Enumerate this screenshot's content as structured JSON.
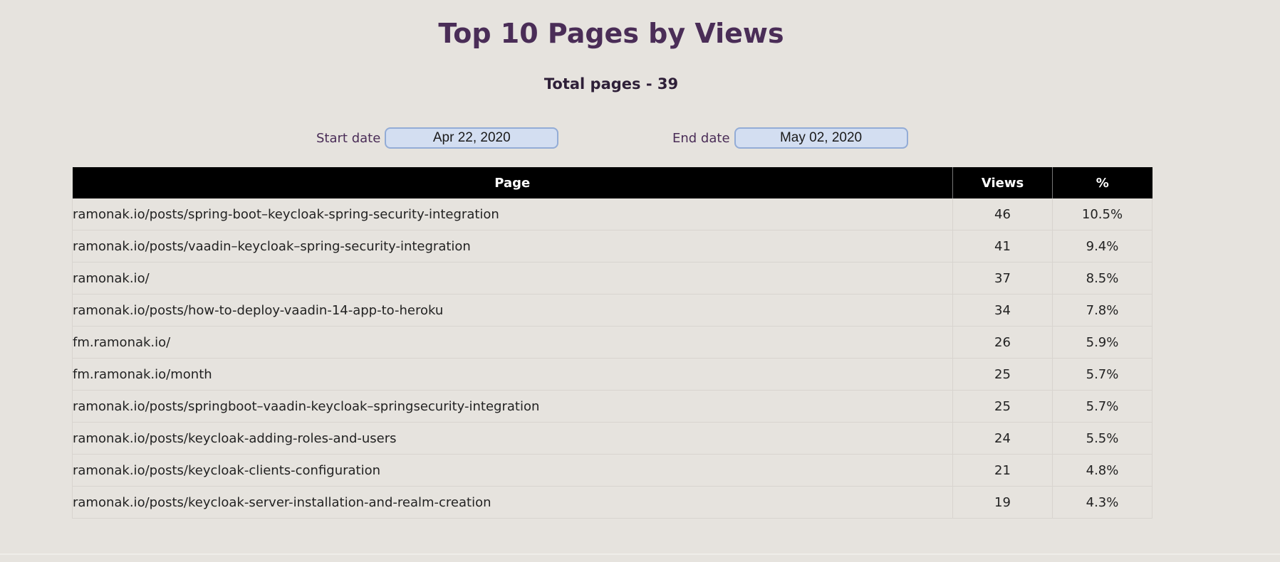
{
  "header": {
    "title": "Top 10 Pages by Views",
    "subtitle": "Total pages - 39"
  },
  "filters": {
    "start_label": "Start date",
    "start_value": "Apr 22, 2020",
    "end_label": "End date",
    "end_value": "May 02, 2020"
  },
  "table": {
    "columns": [
      "Page",
      "Views",
      "%"
    ],
    "rows": [
      {
        "page": "ramonak.io/posts/spring-boot–keycloak-spring-security-integration",
        "views": "46",
        "percent": "10.5%"
      },
      {
        "page": "ramonak.io/posts/vaadin–keycloak–spring-security-integration",
        "views": "41",
        "percent": "9.4%"
      },
      {
        "page": "ramonak.io/",
        "views": "37",
        "percent": "8.5%"
      },
      {
        "page": "ramonak.io/posts/how-to-deploy-vaadin-14-app-to-heroku",
        "views": "34",
        "percent": "7.8%"
      },
      {
        "page": "fm.ramonak.io/",
        "views": "26",
        "percent": "5.9%"
      },
      {
        "page": "fm.ramonak.io/month",
        "views": "25",
        "percent": "5.7%"
      },
      {
        "page": "ramonak.io/posts/springboot–vaadin-keycloak–springsecurity-integration",
        "views": "25",
        "percent": "5.7%"
      },
      {
        "page": "ramonak.io/posts/keycloak-adding-roles-and-users",
        "views": "24",
        "percent": "5.5%"
      },
      {
        "page": "ramonak.io/posts/keycloak-clients-configuration",
        "views": "21",
        "percent": "4.8%"
      },
      {
        "page": "ramonak.io/posts/keycloak-server-installation-and-realm-creation",
        "views": "19",
        "percent": "4.3%"
      }
    ]
  }
}
